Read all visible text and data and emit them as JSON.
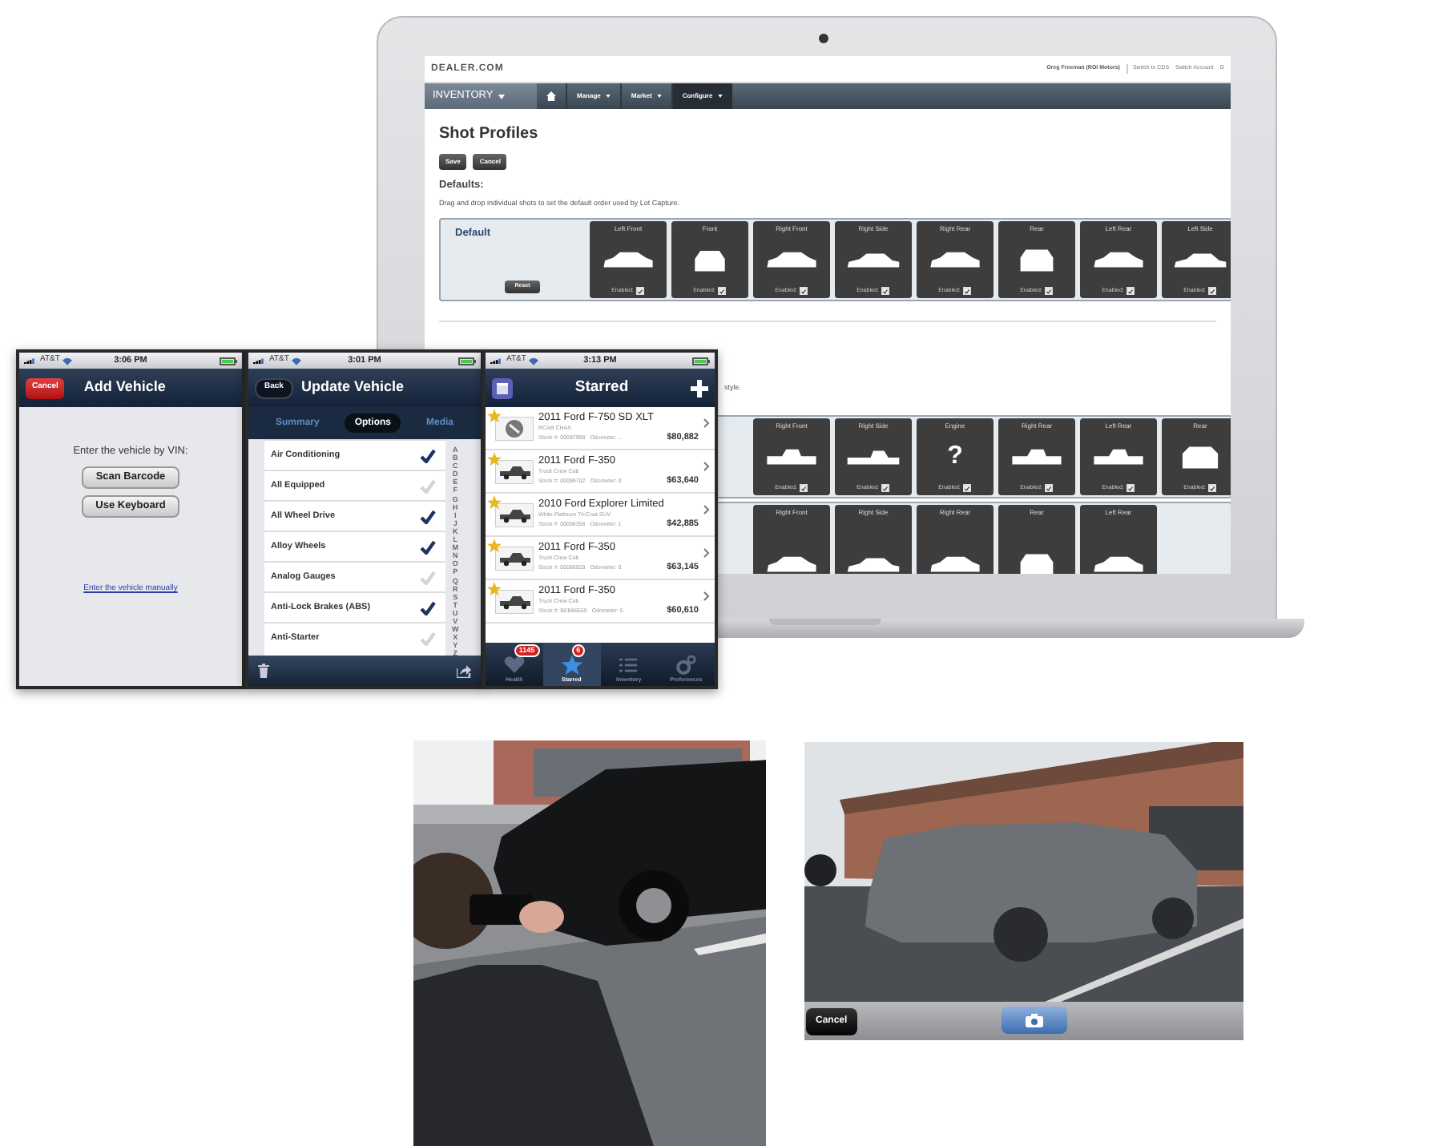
{
  "laptop": {
    "header": {
      "logo": "DEALER.COM",
      "user": "Greg Freeman (ROI Motors)",
      "links": [
        "Switch to CDS",
        "Switch Account",
        "G"
      ]
    },
    "nav": [
      {
        "kind": "app",
        "label": "INVENTORY",
        "selected": false
      },
      {
        "kind": "home",
        "selected": false
      },
      {
        "kind": "menu",
        "label": "Manage",
        "selected": false
      },
      {
        "kind": "menu",
        "label": "Market",
        "selected": false
      },
      {
        "kind": "menu",
        "label": "Configure",
        "selected": true
      }
    ],
    "page": {
      "title": "Shot Profiles",
      "buttons": [
        "Save",
        "Cancel"
      ],
      "section": "Defaults:",
      "description": "Drag and drop individual shots to set the default order used by Lot Capture.",
      "profiles": [
        {
          "name": "Default",
          "reset": "Reset",
          "shots": [
            {
              "label": "Left Front",
              "kind": "car_quarter",
              "enabled_text": "Enabled:",
              "enabled": true
            },
            {
              "label": "Front",
              "kind": "car_front",
              "enabled_text": "Enabled:",
              "enabled": true
            },
            {
              "label": "Right Front",
              "kind": "car_quarter",
              "enabled_text": "Enabled:",
              "enabled": true
            },
            {
              "label": "Right Side",
              "kind": "car_side",
              "enabled_text": "Enabled:",
              "enabled": true
            },
            {
              "label": "Right Rear",
              "kind": "car_quarter",
              "enabled_text": "Enabled:",
              "enabled": true
            },
            {
              "label": "Rear",
              "kind": "car_rear",
              "enabled_text": "Enabled:",
              "enabled": true
            },
            {
              "label": "Left Rear",
              "kind": "car_quarter",
              "enabled_text": "Enabled:",
              "enabled": true
            },
            {
              "label": "Left Side",
              "kind": "car_side",
              "enabled_text": "Enabled:",
              "enabled": true
            }
          ]
        },
        {
          "fragment": "style.",
          "shots": [
            {
              "label": "Right Front",
              "kind": "truck_quarter",
              "enabled_text": "Enabled:",
              "enabled": true
            },
            {
              "label": "Right Side",
              "kind": "truck_side",
              "enabled_text": "Enabled:",
              "enabled": true
            },
            {
              "label": "Engine",
              "kind": "glyph",
              "glyph": "?",
              "enabled_text": "Enabled:",
              "enabled": true
            },
            {
              "label": "Right Rear",
              "kind": "truck_quarter",
              "enabled_text": "Enabled:",
              "enabled": true
            },
            {
              "label": "Left Rear",
              "kind": "truck_quarter",
              "enabled_text": "Enabled:",
              "enabled": true
            },
            {
              "label": "Rear",
              "kind": "truck_rear",
              "enabled_text": "Enabled:",
              "enabled": true
            }
          ]
        },
        {
          "shots": [
            {
              "label": "Right Front",
              "kind": "car_quarter"
            },
            {
              "label": "Right Side",
              "kind": "car_side"
            },
            {
              "label": "Right Rear",
              "kind": "car_quarter"
            },
            {
              "label": "Rear",
              "kind": "car_rear"
            },
            {
              "label": "Left Rear",
              "kind": "car_quarter"
            }
          ]
        }
      ]
    }
  },
  "phones": [
    {
      "kind": "add",
      "status": {
        "carrier": "AT&T",
        "time": "3:06 PM"
      },
      "nav": {
        "button": "Cancel",
        "title": "Add Vehicle"
      },
      "prompt": "Enter the vehicle by VIN:",
      "buttons": [
        "Scan Barcode",
        "Use Keyboard"
      ],
      "link": "Enter the vehicle manually"
    },
    {
      "kind": "options",
      "status": {
        "carrier": "AT&T",
        "time": "3:01 PM"
      },
      "nav": {
        "button": "Back",
        "title": "Update Vehicle"
      },
      "segments": [
        {
          "label": "Summary",
          "selected": false
        },
        {
          "label": "Options",
          "selected": true
        },
        {
          "label": "Media",
          "selected": false
        }
      ],
      "options": [
        {
          "label": "Air Conditioning",
          "checked": true
        },
        {
          "label": "All Equipped",
          "checked": false
        },
        {
          "label": "All Wheel Drive",
          "checked": true
        },
        {
          "label": "Alloy Wheels",
          "checked": true
        },
        {
          "label": "Analog Gauges",
          "checked": false
        },
        {
          "label": "Anti-Lock Brakes (ABS)",
          "checked": true
        },
        {
          "label": "Anti-Starter",
          "checked": false
        }
      ],
      "index": [
        "A",
        "B",
        "C",
        "D",
        "E",
        "F",
        "G",
        "H",
        "I",
        "J",
        "K",
        "L",
        "M",
        "N",
        "O",
        "P",
        "Q",
        "R",
        "S",
        "T",
        "U",
        "V",
        "W",
        "X",
        "Y",
        "Z"
      ]
    },
    {
      "kind": "starred",
      "status": {
        "carrier": "AT&T",
        "time": "3:13 PM"
      },
      "nav": {
        "title": "Starred"
      },
      "vehicles": [
        {
          "title": "2011 Ford F-750 SD XLT",
          "subtitle": "RCAB CHAS",
          "stock": "Stock #: 00097998",
          "odometer": "Odometer: ...",
          "price": "$80,882",
          "starred": true,
          "kind": "emblem"
        },
        {
          "title": "2011 Ford F-350",
          "subtitle": "Truck Crew Cab",
          "stock": "Stock #: 00099702",
          "odometer": "Odometer: 0",
          "price": "$63,640",
          "starred": true
        },
        {
          "title": "2010 Ford Explorer Limited",
          "subtitle": "White Platinum Tri-Coat SUV",
          "stock": "Stock #: 00096358",
          "odometer": "Odometer: 1",
          "price": "$42,885",
          "starred": true
        },
        {
          "title": "2011 Ford F-350",
          "subtitle": "Truck Crew Cab",
          "stock": "Stock #: 00086929",
          "odometer": "Odometer: 0",
          "price": "$63,145",
          "starred": true
        },
        {
          "title": "2011 Ford F-350",
          "subtitle": "Truck Crew Cab",
          "stock": "Stock #: BEB86550",
          "odometer": "Odometer: 0",
          "price": "$60,610",
          "starred": true
        }
      ],
      "tabs": [
        {
          "label": "Health",
          "badge": "1145",
          "selected": false
        },
        {
          "label": "Starred",
          "badge": "6",
          "selected": true
        },
        {
          "label": "Inventory",
          "selected": false
        },
        {
          "label": "Preferences",
          "selected": false
        }
      ]
    }
  ],
  "camera": {
    "cancel": "Cancel"
  }
}
